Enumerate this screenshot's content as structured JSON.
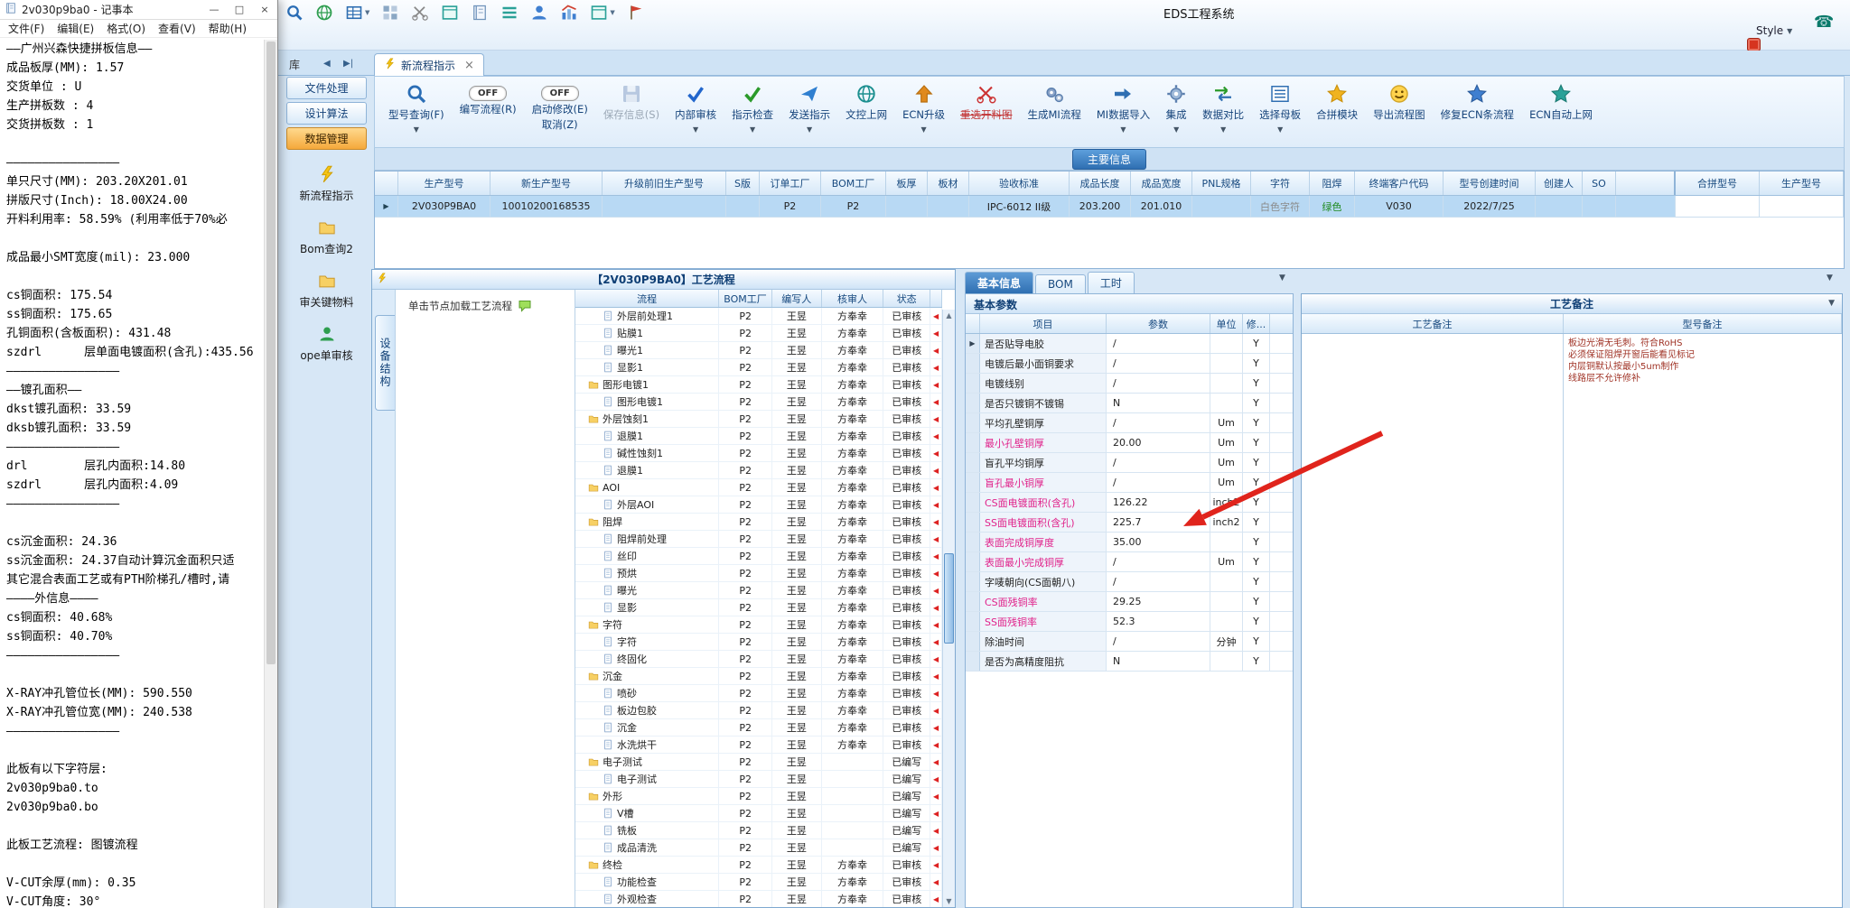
{
  "notepad": {
    "title": "2v030p9ba0 - 记事本",
    "menu": [
      "文件(F)",
      "编辑(E)",
      "格式(O)",
      "查看(V)",
      "帮助(H)"
    ],
    "window_buttons": [
      "—",
      "□",
      "×"
    ],
    "lines": [
      "——广州兴森快捷拼板信息——",
      "成品板厚(MM): 1.57",
      "交货单位 : U",
      "生产拼板数 : 4",
      "交货拼板数 : 1",
      "",
      "————————————————",
      "单只尺寸(MM): 203.20X201.01",
      "拼版尺寸(Inch): 18.00X24.00",
      "开料利用率: 58.59% (利用率低于70%必",
      "",
      "成品最小SMT宽度(mil): 23.000",
      "",
      "cs铜面积: 175.54",
      "ss铜面积: 175.65",
      "孔铜面积(含板面积): 431.48",
      "szdrl      层单面电镀面积(含孔):435.56",
      "————————————————",
      "——镀孔面积——",
      "dkst镀孔面积: 33.59",
      "dksb镀孔面积: 33.59",
      "————————————————",
      "drl        层孔内面积:14.80",
      "szdrl      层孔内面积:4.09",
      "————————————————",
      "",
      "cs沉金面积: 24.36",
      "ss沉金面积: 24.37自动计算沉金面积只适",
      "其它混合表面工艺或有PTH阶梯孔/槽时,请",
      "————外信息————",
      "cs铜面积: 40.68%",
      "ss铜面积: 40.70%",
      "————————————————",
      "",
      "X-RAY冲孔管位长(MM): 590.550",
      "X-RAY冲孔管位宽(MM): 240.538",
      "————————————————",
      "",
      "此板有以下字符层:",
      "2v030p9ba0.to",
      "2v030p9ba0.bo",
      "",
      "此板工艺流程: 图镀流程",
      "",
      "V-CUT余厚(mm): 0.35",
      "V-CUT角度: 30°"
    ]
  },
  "app": {
    "title": "EDS工程系统",
    "style_label": "Style",
    "library_label": "库",
    "top_icons": [
      {
        "name": "search-icon",
        "type": "search"
      },
      {
        "name": "globe-icon",
        "type": "globe"
      },
      {
        "name": "table-icon",
        "type": "table",
        "dropdown": true
      },
      {
        "name": "grid-icon",
        "type": "gridgray"
      },
      {
        "name": "scissors-icon",
        "type": "cut"
      },
      {
        "name": "panel-icon",
        "type": "board"
      },
      {
        "name": "notebook-icon",
        "type": "book"
      },
      {
        "name": "menu-lines-icon",
        "type": "hamb"
      },
      {
        "name": "user-icon",
        "type": "user"
      },
      {
        "name": "chart-icon",
        "type": "chart"
      },
      {
        "name": "board-icon",
        "type": "board",
        "dropdown": true
      },
      {
        "name": "flag-icon",
        "type": "flag"
      }
    ],
    "tab": {
      "label": "新流程指示",
      "close": "×"
    },
    "toolbar": [
      {
        "label": "型号查询(F)",
        "icon": "search",
        "dropdown": true
      },
      {
        "label": "编写流程(R)",
        "toggle": "OFF"
      },
      {
        "label": "启动修改(E)",
        "label2": "取消(Z)",
        "toggle": "OFF"
      },
      {
        "label": "保存信息(S)",
        "icon": "disk",
        "disabled": true
      },
      {
        "label": "内部审核",
        "icon": "check",
        "dropdown": true
      },
      {
        "label": "指示检查",
        "icon": "check2",
        "dropdown": true
      },
      {
        "label": "发送指示",
        "icon": "send",
        "dropdown": true
      },
      {
        "label": "文控上网",
        "icon": "net"
      },
      {
        "label": "ECN升级",
        "icon": "up",
        "dropdown": true
      },
      {
        "label": "重选开料图",
        "icon": "cutred",
        "strike": true
      },
      {
        "label": "生成MI流程",
        "icon": "gears"
      },
      {
        "label": "MI数据导入",
        "icon": "import",
        "dropdown": true
      },
      {
        "label": "集成",
        "icon": "gear",
        "dropdown": true
      },
      {
        "label": "数据对比",
        "icon": "compare",
        "dropdown": true
      },
      {
        "label": "选择母板",
        "icon": "mlist",
        "dropdown": true
      },
      {
        "label": "合拼模块",
        "icon": "star"
      },
      {
        "label": "导出流程图",
        "icon": "smile"
      },
      {
        "label": "修复ECN条流程",
        "icon": "star2"
      },
      {
        "label": "ECN自动上网",
        "icon": "star3"
      }
    ],
    "main_info": {
      "title": "主要信息",
      "columns": [
        "",
        "生产型号",
        "新生产型号",
        "升级前旧生产型号",
        "S版",
        "订单工厂",
        "BOM工厂",
        "板厚",
        "板材",
        "验收标准",
        "成品长度",
        "成品宽度",
        "PNL规格",
        "字符",
        "阻焊",
        "终端客户代码",
        "型号创建时间",
        "创建人",
        "SO"
      ],
      "row": [
        "▶",
        "2V030P9BA0",
        "10010200168535",
        "",
        "",
        "P2",
        "P2",
        "",
        "",
        "IPC-6012 II级",
        "203.200",
        "201.010",
        "",
        "白色字符",
        "绿色",
        "V030",
        "2022/7/25",
        "",
        ""
      ],
      "row_colors": {
        "13": "#8a8a8a",
        "14": "#1f8a1f"
      },
      "right_columns": [
        "合拼型号",
        "生产型号"
      ]
    },
    "left_nav": {
      "buttons": [
        {
          "label": "文件处理"
        },
        {
          "label": "设计算法"
        },
        {
          "label": "数据管理",
          "active": true
        }
      ],
      "items": [
        {
          "label": "新流程指示",
          "icon": "bolt"
        },
        {
          "label": "Bom查询2",
          "icon": "folder"
        },
        {
          "label": "审关键物料",
          "icon": "folder"
        },
        {
          "label": "ope单审核",
          "icon": "usergreen"
        }
      ]
    },
    "process_panel": {
      "title": "【2V030P9BA0】工艺流程",
      "side_tab": "设备结构",
      "hint": "单击节点加载工艺流程",
      "columns": [
        "流程",
        "BOM工厂",
        "编写人",
        "核审人",
        "状态"
      ],
      "rows": [
        [
          "外层前处理1",
          "d",
          "P2",
          "王昱",
          "方奉幸",
          "已审核"
        ],
        [
          "贴膜1",
          "d",
          "P2",
          "王昱",
          "方奉幸",
          "已审核"
        ],
        [
          "曝光1",
          "d",
          "P2",
          "王昱",
          "方奉幸",
          "已审核"
        ],
        [
          "显影1",
          "d",
          "P2",
          "王昱",
          "方奉幸",
          "已审核"
        ],
        [
          "图形电镀1",
          "f",
          "P2",
          "王昱",
          "方奉幸",
          "已审核"
        ],
        [
          "图形电镀1",
          "d",
          "P2",
          "王昱",
          "方奉幸",
          "已审核"
        ],
        [
          "外层蚀刻1",
          "f",
          "P2",
          "王昱",
          "方奉幸",
          "已审核"
        ],
        [
          "退膜1",
          "d",
          "P2",
          "王昱",
          "方奉幸",
          "已审核"
        ],
        [
          "碱性蚀刻1",
          "d",
          "P2",
          "王昱",
          "方奉幸",
          "已审核"
        ],
        [
          "退膜1",
          "d",
          "P2",
          "王昱",
          "方奉幸",
          "已审核"
        ],
        [
          "AOI",
          "f",
          "P2",
          "王昱",
          "方奉幸",
          "已审核"
        ],
        [
          "外层AOI",
          "d",
          "P2",
          "王昱",
          "方奉幸",
          "已审核"
        ],
        [
          "阻焊",
          "f",
          "P2",
          "王昱",
          "方奉幸",
          "已审核"
        ],
        [
          "阻焊前处理",
          "d",
          "P2",
          "王昱",
          "方奉幸",
          "已审核"
        ],
        [
          "丝印",
          "d",
          "P2",
          "王昱",
          "方奉幸",
          "已审核"
        ],
        [
          "预烘",
          "d",
          "P2",
          "王昱",
          "方奉幸",
          "已审核"
        ],
        [
          "曝光",
          "d",
          "P2",
          "王昱",
          "方奉幸",
          "已审核"
        ],
        [
          "显影",
          "d",
          "P2",
          "王昱",
          "方奉幸",
          "已审核"
        ],
        [
          "字符",
          "f",
          "P2",
          "王昱",
          "方奉幸",
          "已审核"
        ],
        [
          "字符",
          "d",
          "P2",
          "王昱",
          "方奉幸",
          "已审核"
        ],
        [
          "终固化",
          "d",
          "P2",
          "王昱",
          "方奉幸",
          "已审核"
        ],
        [
          "沉金",
          "f",
          "P2",
          "王昱",
          "方奉幸",
          "已审核"
        ],
        [
          "喷砂",
          "d",
          "P2",
          "王昱",
          "方奉幸",
          "已审核"
        ],
        [
          "板边包胶",
          "d",
          "P2",
          "王昱",
          "方奉幸",
          "已审核"
        ],
        [
          "沉金",
          "d",
          "P2",
          "王昱",
          "方奉幸",
          "已审核"
        ],
        [
          "水洗烘干",
          "d",
          "P2",
          "王昱",
          "方奉幸",
          "已审核"
        ],
        [
          "电子测试",
          "f",
          "P2",
          "王昱",
          "",
          "已编写"
        ],
        [
          "电子测试",
          "d",
          "P2",
          "王昱",
          "",
          "已编写"
        ],
        [
          "外形",
          "f",
          "P2",
          "王昱",
          "",
          "已编写"
        ],
        [
          "V槽",
          "d",
          "P2",
          "王昱",
          "",
          "已编写"
        ],
        [
          "铣板",
          "d",
          "P2",
          "王昱",
          "",
          "已编写"
        ],
        [
          "成品清洗",
          "d",
          "P2",
          "王昱",
          "",
          "已编写"
        ],
        [
          "终检",
          "f",
          "P2",
          "王昱",
          "方奉幸",
          "已审核"
        ],
        [
          "功能检查",
          "d",
          "P2",
          "王昱",
          "方奉幸",
          "已审核"
        ],
        [
          "外观检查",
          "d",
          "P2",
          "王昱",
          "方奉幸",
          "已审核"
        ]
      ]
    },
    "detail_panel": {
      "tabs": [
        "基本信息",
        "BOM",
        "工时"
      ],
      "active_tab": "基本信息",
      "section": "基本参数",
      "columns": [
        "项目",
        "参数",
        "单位",
        "修..."
      ],
      "rows": [
        [
          "是否贴导电胶",
          "/",
          "",
          "Y",
          0
        ],
        [
          "电镀后最小面铜要求",
          "/",
          "",
          "Y",
          0
        ],
        [
          "电镀线别",
          "/",
          "",
          "Y",
          0
        ],
        [
          "是否只镀铜不镀锡",
          "N",
          "",
          "Y",
          0
        ],
        [
          "平均孔壁铜厚",
          "/",
          "Um",
          "Y",
          0
        ],
        [
          "最小孔壁铜厚",
          "20.00",
          "Um",
          "Y",
          1
        ],
        [
          "盲孔平均铜厚",
          "/",
          "Um",
          "Y",
          0
        ],
        [
          "盲孔最小铜厚",
          "/",
          "Um",
          "Y",
          1
        ],
        [
          "CS面电镀面积(含孔)",
          "126.22",
          "inch2",
          "Y",
          1
        ],
        [
          "SS面电镀面积(含孔)",
          "225.7",
          "inch2",
          "Y",
          1
        ],
        [
          "表面完成铜厚度",
          "35.00",
          "",
          "Y",
          1
        ],
        [
          "表面最小完成铜厚",
          "/",
          "Um",
          "Y",
          1
        ],
        [
          "字唛朝向(CS面朝八)",
          "/",
          "",
          "Y",
          0
        ],
        [
          "CS面残铜率",
          "29.25",
          "",
          "Y",
          1
        ],
        [
          "SS面残铜率",
          "52.3",
          "",
          "Y",
          1
        ],
        [
          "除油时间",
          "/",
          "分钟",
          "Y",
          0
        ],
        [
          "是否为高精度阻抗",
          "N",
          "",
          "Y",
          0
        ]
      ]
    },
    "remark_panel": {
      "title": "工艺备注",
      "columns": [
        "工艺备注",
        "型号备注"
      ],
      "model_remarks": [
        "板边光滑无毛刺。符合RoHS",
        "必须保证阻焊开窗后能看见标记",
        "内层铜默认按最小5um制作",
        "线路层不允许修补"
      ]
    },
    "annotation": {
      "shape": "arrow",
      "color": "#e0241c",
      "target": "CS面电镀面积(含孔) 126.22"
    }
  },
  "colors": {
    "accent": "#2f6fb2",
    "grid_header_text": "#17497f",
    "highlight_param": "#e0218a",
    "status_green": "#1f8a1f",
    "active_nav": "#f5a93b",
    "arrow": "#e0241c"
  }
}
